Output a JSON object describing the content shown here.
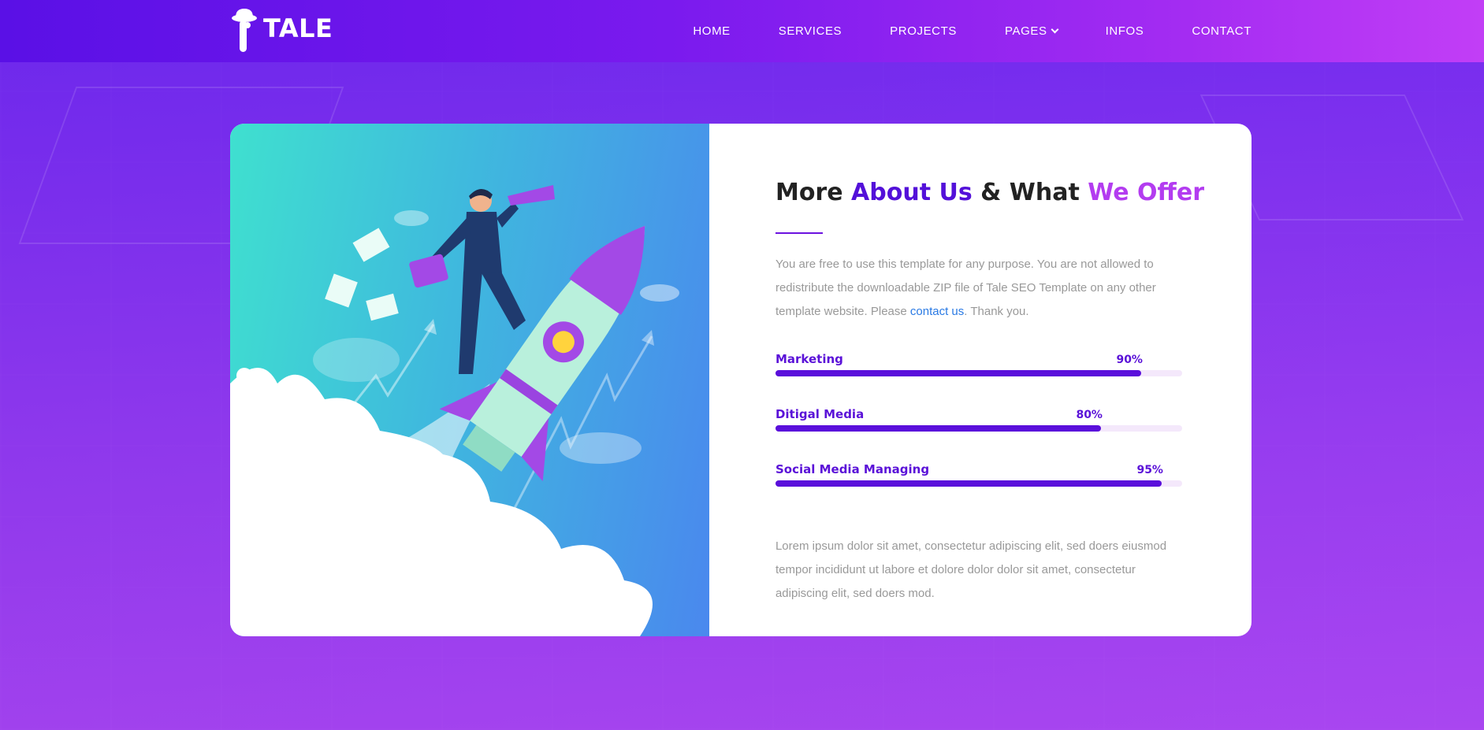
{
  "brand": {
    "name": "TALE"
  },
  "nav": {
    "items": [
      {
        "label": "HOME"
      },
      {
        "label": "SERVICES"
      },
      {
        "label": "PROJECTS"
      },
      {
        "label": "PAGES",
        "has_dropdown": true
      },
      {
        "label": "INFOS"
      },
      {
        "label": "CONTACT"
      }
    ]
  },
  "about": {
    "heading_part1": "More ",
    "heading_part2": "About Us",
    "heading_part3": " & What ",
    "heading_part4": "We Offer",
    "intro_before_link": "You are free to use this template for any purpose. You are not allowed to redistribute the downloadable ZIP file of Tale SEO Template on any other template website. Please ",
    "intro_link": "contact us",
    "intro_after_link": ". Thank you.",
    "skills": [
      {
        "name": "Marketing",
        "percent_label": "90%",
        "value": 0.9
      },
      {
        "name": "Ditigal Media",
        "percent_label": "80%",
        "value": 0.8
      },
      {
        "name": "Social Media Managing",
        "percent_label": "95%",
        "value": 0.95
      }
    ],
    "footer_text": "Lorem ipsum dolor sit amet, consectetur adipiscing elit, sed doers eiusmod tempor incididunt ut labore et dolore dolor dolor sit amet, consectetur adipiscing elit, sed doers mod."
  },
  "illustration": {
    "icon": "rocket-businessman-illustration"
  },
  "colors": {
    "accent_primary": "#5310d9",
    "accent_secondary": "#b33cf0",
    "link": "#2a7ae4"
  }
}
